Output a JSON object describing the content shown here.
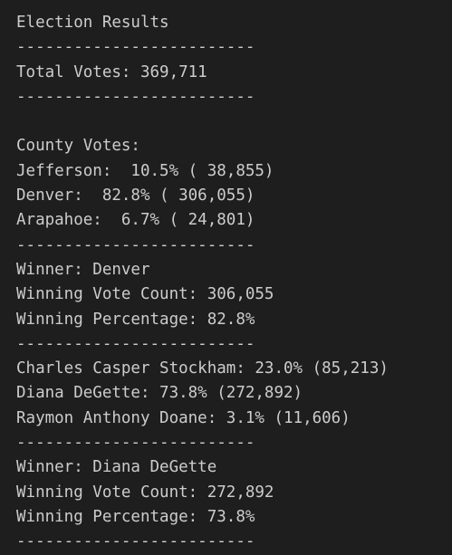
{
  "output": {
    "title": "Election Results",
    "divider": "-------------------------",
    "total_votes": "Total Votes: 369,711",
    "county_header": "County Votes:",
    "counties": [
      "Jefferson:  10.5% ( 38,855)",
      "Denver:  82.8% ( 306,055)",
      "Arapahoe:  6.7% ( 24,801)"
    ],
    "county_winner": {
      "winner": "Winner: Denver",
      "count": "Winning Vote Count: 306,055",
      "percentage": "Winning Percentage: 82.8%"
    },
    "candidates": [
      "Charles Casper Stockham: 23.0% (85,213)",
      "Diana DeGette: 73.8% (272,892)",
      "Raymon Anthony Doane: 3.1% (11,606)"
    ],
    "candidate_winner": {
      "winner": "Winner: Diana DeGette",
      "count": "Winning Vote Count: 272,892",
      "percentage": "Winning Percentage: 73.8%"
    }
  }
}
